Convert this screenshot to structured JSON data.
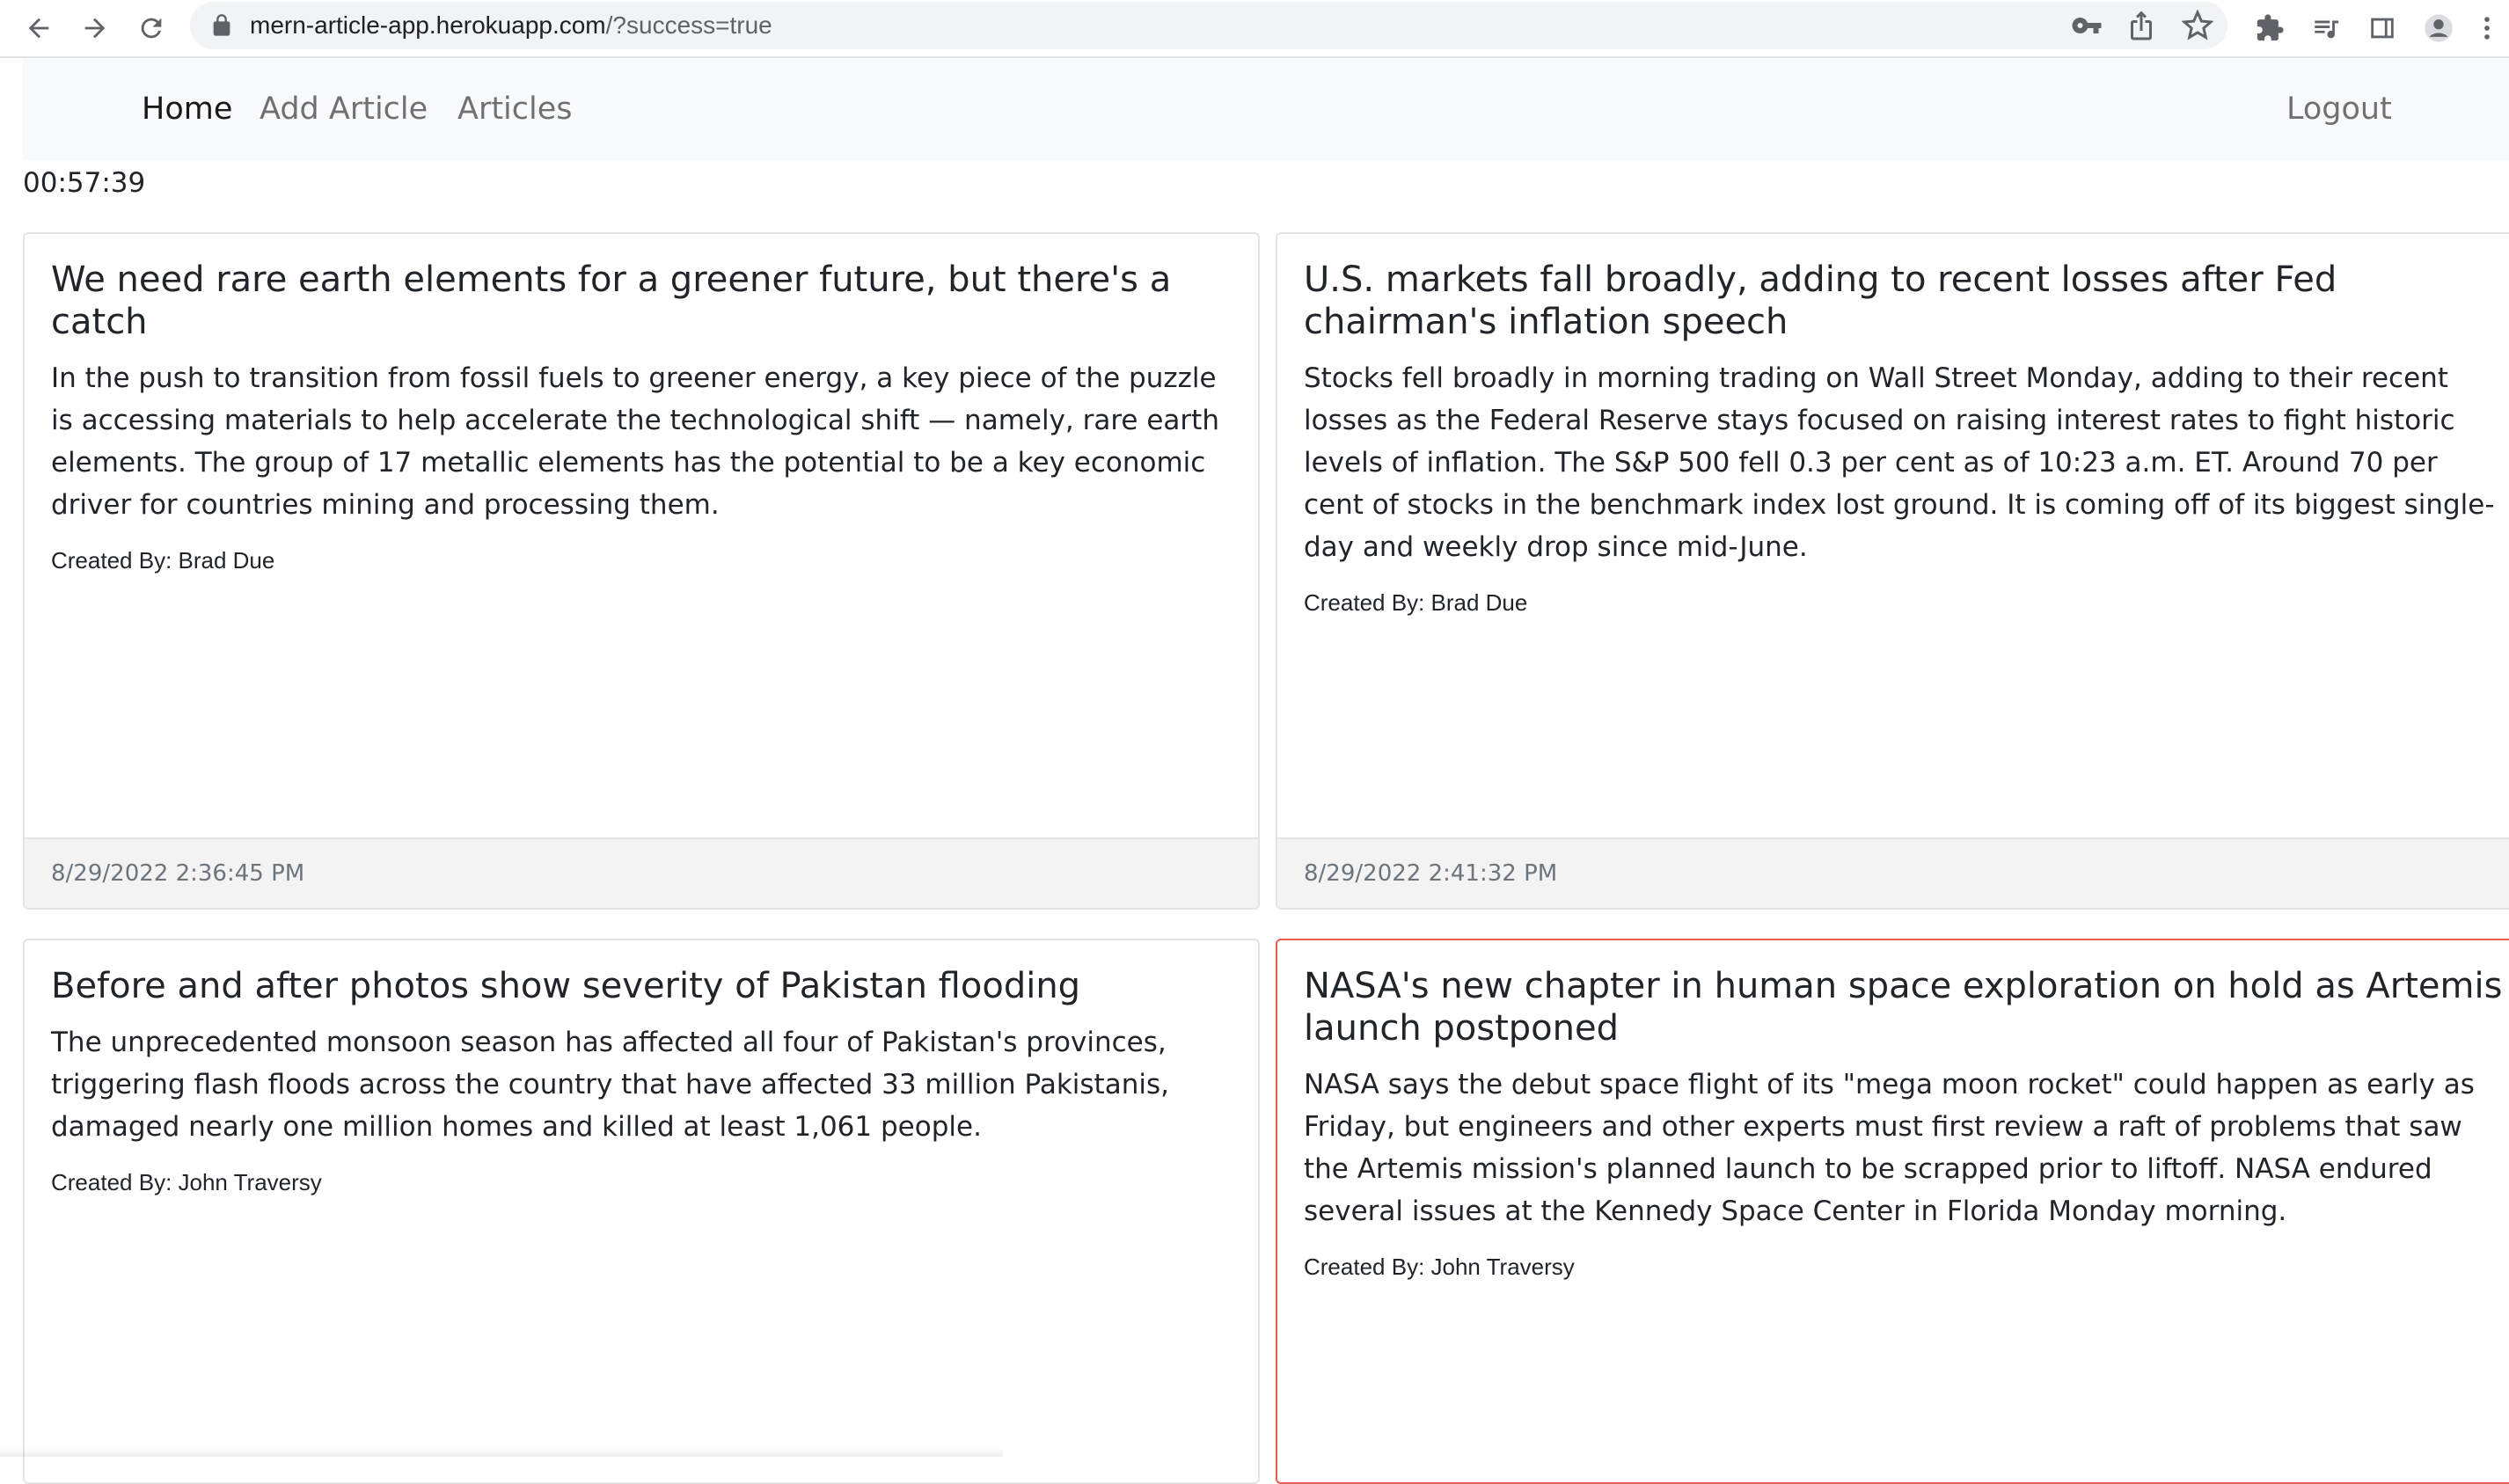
{
  "browser": {
    "url_host": "mern-article-app.herokuapp.com",
    "url_path": "/?success=true",
    "icons": [
      "back-icon",
      "forward-icon",
      "reload-icon",
      "lock-icon",
      "key-icon",
      "share-icon",
      "star-icon",
      "extensions-icon",
      "media-icon",
      "side-panel-icon",
      "profile-icon",
      "menu-icon"
    ]
  },
  "nav": {
    "home": "Home",
    "add_article": "Add Article",
    "articles": "Articles",
    "logout": "Logout"
  },
  "clock": "00:57:39",
  "articles": [
    {
      "title": "We need rare earth elements for a greener future, but there's a catch",
      "body": "In the push to transition from fossil fuels to greener energy, a key piece of the puzzle is accessing materials to help accelerate the technological shift — namely, rare earth elements. The group of 17 metallic elements has the potential to be a key economic driver for countries mining and processing them.",
      "author": "Created By: Brad Due",
      "date": "8/29/2022 2:36:45 PM"
    },
    {
      "title": "U.S. markets fall broadly, adding to recent losses after Fed chairman's inflation speech",
      "body": "Stocks fell broadly in morning trading on Wall Street Monday, adding to their recent losses as the Federal Reserve stays focused on raising interest rates to fight historic levels of inflation. The S&P 500 fell 0.3 per cent as of 10:23 a.m. ET. Around 70 per cent of stocks in the benchmark index lost ground. It is coming off of its biggest single-day and weekly drop since mid-June.",
      "author": "Created By: Brad Due",
      "date": "8/29/2022 2:41:32 PM"
    },
    {
      "title": "Before and after photos show severity of Pakistan flooding",
      "body": "The unprecedented monsoon season has affected all four of Pakistan's provinces, triggering flash floods across the country that have affected 33 million Pakistanis, damaged nearly one million homes and killed at least 1,061 people.",
      "author": "Created By: John Traversy"
    },
    {
      "title": "NASA's new chapter in human space exploration on hold as Artemis launch postponed",
      "body": "NASA says the debut space flight of its \"mega moon rocket\" could happen as early as Friday, but engineers and other experts must first review a raft of problems that saw the Artemis mission's planned launch to be scrapped prior to liftoff. NASA endured several issues at the Kennedy Space Center in Florida Monday morning.",
      "author": "Created By: John Traversy"
    }
  ]
}
